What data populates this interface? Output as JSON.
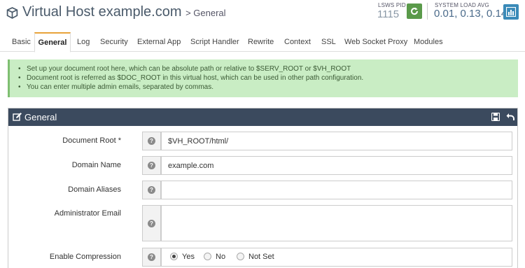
{
  "header": {
    "title": "Virtual Host example.com",
    "breadcrumb": "> General",
    "pid_label": "LSWS PID",
    "pid_value": "1115",
    "load_label": "SYSTEM LOAD AVG",
    "load_value": "0.01, 0.13, 0.14",
    "restart_icon": "refresh-icon",
    "chart_icon": "bar-chart-icon"
  },
  "tabs": [
    {
      "label": "Basic"
    },
    {
      "label": "General"
    },
    {
      "label": "Log"
    },
    {
      "label": "Security"
    },
    {
      "label": "External App"
    },
    {
      "label": "Script Handler"
    },
    {
      "label": "Rewrite"
    },
    {
      "label": "Context"
    },
    {
      "label": "SSL"
    },
    {
      "label": "Web Socket Proxy"
    },
    {
      "label": "Modules"
    }
  ],
  "active_tab": "General",
  "info": [
    "Set up your document root here, which can be absolute path or relative to $SERV_ROOT or $VH_ROOT",
    "Document root is referred as $DOC_ROOT in this virtual host, which can be used in other path configuration.",
    "You can enter multiple admin emails, separated by commas."
  ],
  "panel": {
    "title": "General",
    "fields": {
      "doc_root": {
        "label": "Document Root *",
        "value": "$VH_ROOT/html/"
      },
      "domain_name": {
        "label": "Domain Name",
        "value": "example.com"
      },
      "domain_aliases": {
        "label": "Domain Aliases",
        "value": ""
      },
      "admin_email": {
        "label": "Administrator Email",
        "value": ""
      },
      "compression": {
        "label": "Enable Compression",
        "options": [
          "Yes",
          "No",
          "Not Set"
        ],
        "selected": "Yes"
      }
    }
  },
  "colors": {
    "panel_header": "#3b4a5e",
    "info_bg": "#c9edc4",
    "restart_btn": "#5a9a4a",
    "chart_btn": "#3a8ab8",
    "active_tab_accent": "#e8a33a"
  }
}
